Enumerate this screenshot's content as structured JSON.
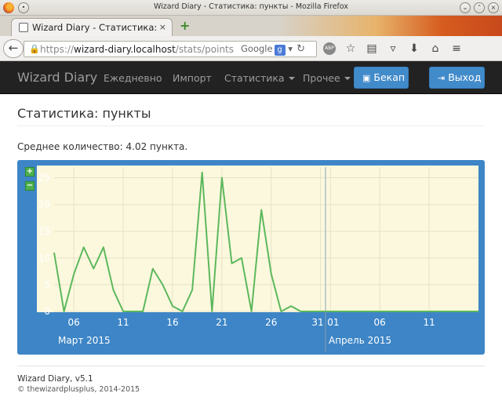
{
  "window": {
    "title": "Wizard Diary - Статистика: пункты - Mozilla Firefox"
  },
  "tab": {
    "title": "Wizard Diary - Статистика: пун…",
    "close_glyph": "×",
    "new_tab_glyph": "+"
  },
  "browser": {
    "url_prefix": "https://",
    "url_host": "wizard-diary.localhost",
    "url_path": "/stats/points",
    "search_engine": "Google",
    "search_letter": "g",
    "abp_label": "ABP"
  },
  "appnav": {
    "brand": "Wizard Diary",
    "links": [
      "Ежедневно",
      "Импорт",
      "Статистика",
      "Прочее"
    ],
    "backup_label": "Бекап",
    "logout_label": "Выход"
  },
  "page": {
    "title": "Статистика: пункты",
    "average_text": "Среднее количество: 4.02 пункта."
  },
  "chart_data": {
    "type": "line",
    "x_dates": [
      "2015-03-04",
      "2015-03-05",
      "2015-03-06",
      "2015-03-07",
      "2015-03-08",
      "2015-03-09",
      "2015-03-10",
      "2015-03-11",
      "2015-03-12",
      "2015-03-13",
      "2015-03-14",
      "2015-03-15",
      "2015-03-16",
      "2015-03-17",
      "2015-03-18",
      "2015-03-19",
      "2015-03-20",
      "2015-03-21",
      "2015-03-22",
      "2015-03-23",
      "2015-03-24",
      "2015-03-25",
      "2015-03-26",
      "2015-03-27",
      "2015-03-28",
      "2015-03-29",
      "2015-03-30",
      "2015-03-31",
      "2015-04-01",
      "2015-04-02",
      "2015-04-03",
      "2015-04-04",
      "2015-04-05",
      "2015-04-06",
      "2015-04-07",
      "2015-04-08",
      "2015-04-09",
      "2015-04-10",
      "2015-04-11",
      "2015-04-12",
      "2015-04-13",
      "2015-04-14",
      "2015-04-15",
      "2015-04-16"
    ],
    "values": [
      11,
      0,
      7,
      12,
      8,
      12,
      4,
      0,
      0,
      0,
      8,
      5,
      1,
      0,
      4,
      26,
      0,
      25,
      9,
      10,
      0,
      19,
      7,
      0,
      1,
      0,
      0,
      0,
      0,
      0,
      0,
      0,
      0,
      0,
      0,
      0,
      0,
      0,
      0,
      0,
      0,
      0,
      0,
      0
    ],
    "ylim": [
      0,
      27
    ],
    "y_ticks": [
      0,
      5,
      10,
      15,
      20,
      25
    ],
    "x_tick_labels": [
      "06",
      "11",
      "16",
      "21",
      "26",
      "31",
      "01",
      "06",
      "11"
    ],
    "month_labels": [
      "Март 2015",
      "Апрель 2015"
    ],
    "line_color": "#5cb85c",
    "background_color": "#fcf8de",
    "panel_color": "#3d85c6",
    "grid": true,
    "zoom_in_label": "+",
    "zoom_out_label": "−"
  },
  "footer": {
    "line1": "Wizard Diary, v5.1",
    "line2": "© thewizardplusplus, 2014-2015"
  }
}
